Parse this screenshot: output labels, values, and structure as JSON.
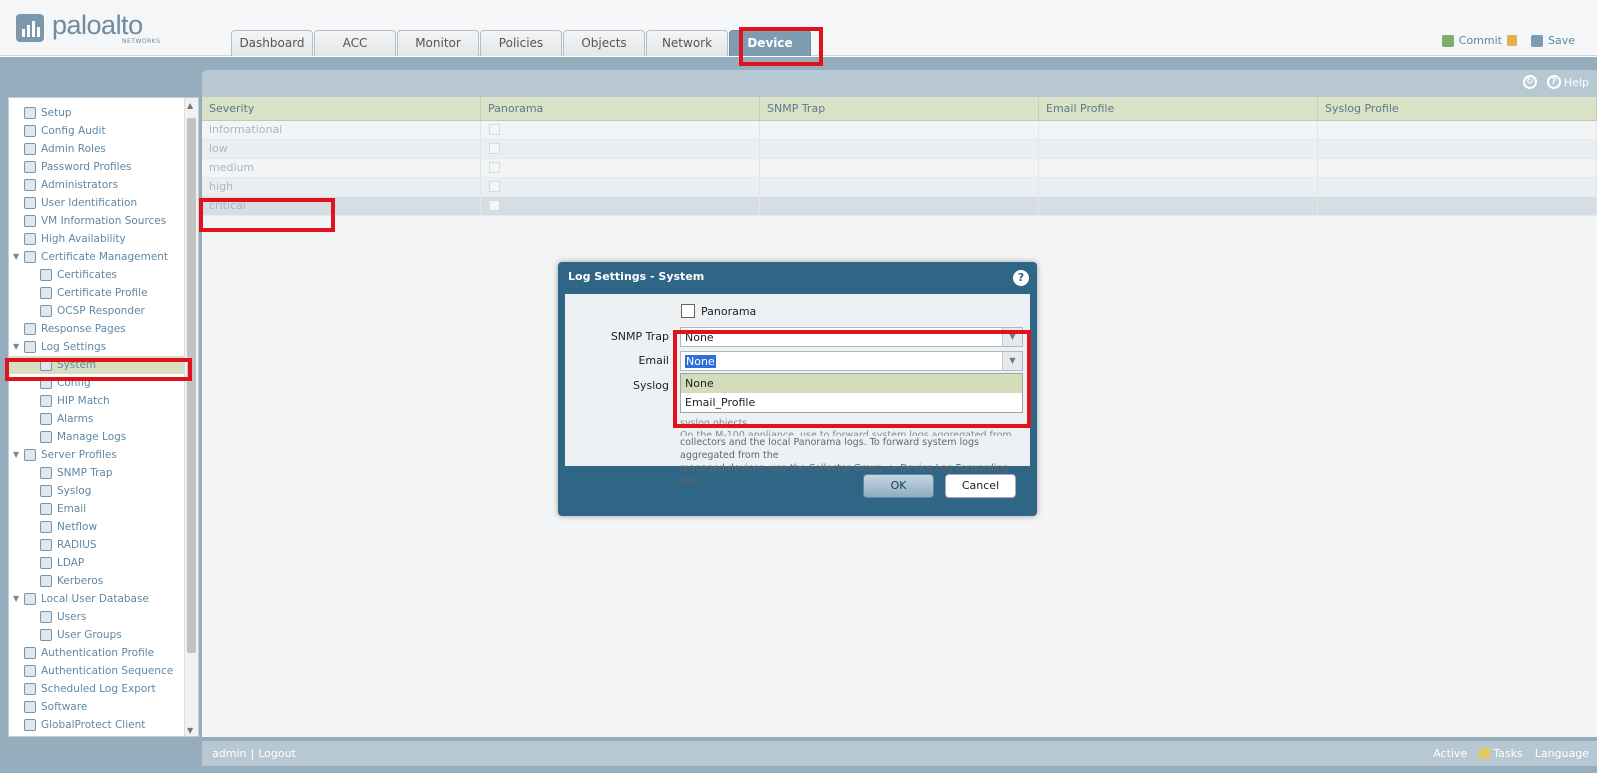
{
  "header": {
    "logo_text": "paloalto",
    "logo_sub": "NETWORKS",
    "tabs": [
      {
        "label": "Dashboard"
      },
      {
        "label": "ACC"
      },
      {
        "label": "Monitor"
      },
      {
        "label": "Policies"
      },
      {
        "label": "Objects"
      },
      {
        "label": "Network"
      },
      {
        "label": "Device"
      }
    ],
    "active_tab": "Device",
    "commit_label": "Commit",
    "save_label": "Save"
  },
  "toolbar": {
    "help_label": "Help"
  },
  "sidebar": {
    "items": [
      {
        "label": "Setup"
      },
      {
        "label": "Config Audit"
      },
      {
        "label": "Admin Roles"
      },
      {
        "label": "Password Profiles"
      },
      {
        "label": "Administrators"
      },
      {
        "label": "User Identification"
      },
      {
        "label": "VM Information Sources"
      },
      {
        "label": "High Availability"
      },
      {
        "label": "Certificate Management"
      },
      {
        "label": "Certificates"
      },
      {
        "label": "Certificate Profile"
      },
      {
        "label": "OCSP Responder"
      },
      {
        "label": "Response Pages"
      },
      {
        "label": "Log Settings"
      },
      {
        "label": "System"
      },
      {
        "label": "Config"
      },
      {
        "label": "HIP Match"
      },
      {
        "label": "Alarms"
      },
      {
        "label": "Manage Logs"
      },
      {
        "label": "Server Profiles"
      },
      {
        "label": "SNMP Trap"
      },
      {
        "label": "Syslog"
      },
      {
        "label": "Email"
      },
      {
        "label": "Netflow"
      },
      {
        "label": "RADIUS"
      },
      {
        "label": "LDAP"
      },
      {
        "label": "Kerberos"
      },
      {
        "label": "Local User Database"
      },
      {
        "label": "Users"
      },
      {
        "label": "User Groups"
      },
      {
        "label": "Authentication Profile"
      },
      {
        "label": "Authentication Sequence"
      },
      {
        "label": "Scheduled Log Export"
      },
      {
        "label": "Software"
      },
      {
        "label": "GlobalProtect Client"
      }
    ],
    "selected": "System"
  },
  "grid": {
    "columns": [
      "Severity",
      "Panorama",
      "SNMP Trap",
      "Email Profile",
      "Syslog Profile"
    ],
    "rows": [
      {
        "severity": "informational"
      },
      {
        "severity": "low"
      },
      {
        "severity": "medium"
      },
      {
        "severity": "high"
      },
      {
        "severity": "critical"
      }
    ]
  },
  "dialog": {
    "title": "Log Settings - System",
    "panorama_label": "Panorama",
    "snmp_label": "SNMP Trap",
    "snmp_value": "None",
    "email_label": "Email",
    "email_value": "None",
    "syslog_label": "Syslog",
    "dropdown_options": [
      "None",
      "Email_Profile"
    ],
    "help_top": "syslog objects.",
    "help_cut": "On the M-100 appliance, use to forward system logs aggregated from the managed",
    "help_lines": [
      "collectors and the local Panorama logs. To forward system logs aggregated from the",
      "managed devices, use the Collector Group -> Device Log Forwarding tab."
    ],
    "ok_label": "OK",
    "cancel_label": "Cancel"
  },
  "statusbar": {
    "user": "admin",
    "separator": "|",
    "logout": "Logout",
    "active": "Active",
    "tasks": "Tasks",
    "language": "Language"
  }
}
